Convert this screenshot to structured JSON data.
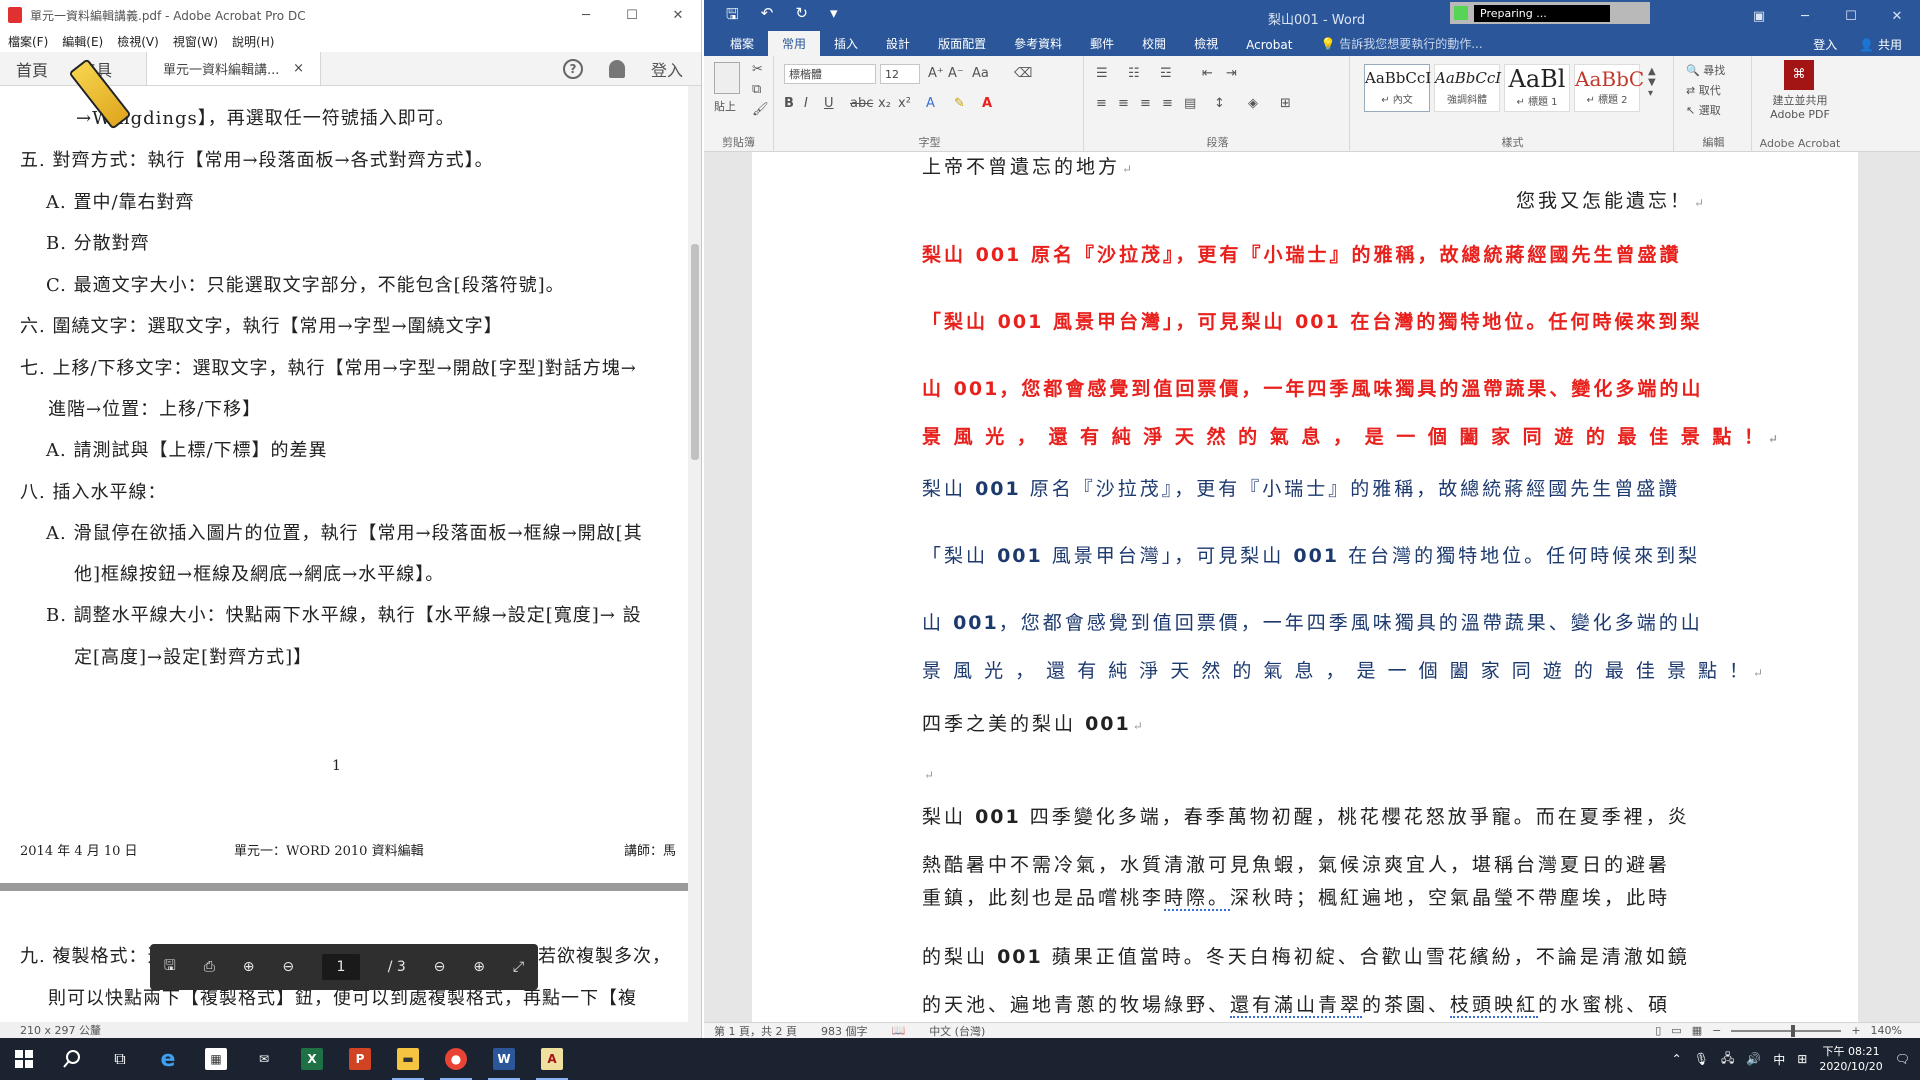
{
  "acrobat": {
    "window_title": "單元一資料編輯講義.pdf - Adobe Acrobat Pro DC",
    "window_controls": [
      "─",
      "☐",
      "✕"
    ],
    "menu": [
      "檔案(F)",
      "編輯(E)",
      "檢視(V)",
      "視窗(W)",
      "說明(H)"
    ],
    "tabs": {
      "home": "首頁",
      "tools": "工具",
      "doc": "單元一資料編輯講...",
      "close": "×",
      "signin": "登入",
      "help": "?"
    },
    "page_lines": [
      "→Wingdings】，再選取任一符號插入即可。",
      "五. 對齊方式：執行【常用→段落面板→各式對齊方式】。",
      "A.  置中/靠右對齊",
      "B.  分散對齊",
      "C.  最適文字大小：只能選取文字部分，不能包含[段落符號]。",
      "六. 圍繞文字：選取文字，執行【常用→字型→圍繞文字】",
      "七. 上移/下移文字：選取文字，執行【常用→字型→開啟[字型]對話方塊→",
      "進階→位置：上移/下移】",
      "A.  請測試與【上標/下標】的差異",
      "八. 插入水平線：",
      "A.  滑鼠停在欲插入圖片的位置，執行【常用→段落面板→框線→開啟[其",
      "他]框線按鈕→框線及網底→網底→水平線】。",
      "B.  調整水平線大小：快點兩下水平線，執行【水平線→設定[寬度]→ 設",
      "定[高度]→設定[對齊方式]】"
    ],
    "page_number": "1",
    "header_date": "2014 年 4 月 10 日",
    "header_unit": "單元一：WORD 2010 資料編輯",
    "header_teacher": "講師：馬",
    "page2_lines": [
      "九. 複製格式：選",
      "若欲複製多次，",
      "則可以快點兩下【複製格式】鈕，便可以到處複製格式，再點一下【複"
    ],
    "status_size": "210 x 297 公釐",
    "toolbar": {
      "current_page": "1",
      "total_pages": "/ 3"
    }
  },
  "word": {
    "window_title": "梨山001 - Word",
    "preparing": "Preparing ...",
    "ribbon_tabs": [
      "檔案",
      "常用",
      "插入",
      "設計",
      "版面配置",
      "參考資料",
      "郵件",
      "校閱",
      "檢視",
      "Acrobat"
    ],
    "active_tab": "常用",
    "tell_me": "告訴我您想要執行的動作...",
    "signin": "登入",
    "share": "共用",
    "groups": {
      "clipboard": "剪貼簿",
      "font": "字型",
      "paragraph": "段落",
      "styles": "樣式",
      "editing": "編輯",
      "acrobat": "Adobe Acrobat"
    },
    "paste": "貼上",
    "font_name": "標楷體",
    "font_size": "12",
    "styles": [
      {
        "sample": "AaBbCcI",
        "name": "↵ 內文"
      },
      {
        "sample": "AaBbCcI",
        "name": "強調斜體"
      },
      {
        "sample": "AaBl",
        "name": "↵ 標題 1"
      },
      {
        "sample": "AaBbC",
        "name": "↵ 標題 2"
      }
    ],
    "editing": {
      "find": "尋找",
      "replace": "取代",
      "select": "選取"
    },
    "acrobat_btn": [
      "建立並共用",
      "Adobe PDF"
    ],
    "doc": {
      "line1": "上帝不曾遺忘的地方",
      "line2": "您我又怎能遺忘！",
      "para_red": [
        [
          "梨山",
          "001",
          "原名『沙拉茂』，更有『小瑞士』的雅稱，故總統蔣經國先生曾盛讚"
        ],
        [
          "「梨山",
          "001",
          "風景甲台灣」，可見梨山",
          "001",
          "在台灣的獨特地位。任何時候來到梨"
        ],
        [
          "山",
          "001",
          "，您都會感覺到值回票價，一年四季風味獨具的溫帶蔬果、變化多端的山"
        ],
        [
          "景 風 光 ， 還 有 純 淨 天 然 的 氣 息 ， 是 一 個 闔 家 同 遊 的 最 佳 景 點 ！"
        ]
      ],
      "heading": [
        "四季之美的梨山",
        "001"
      ],
      "para3": [
        [
          "梨山",
          "001",
          "四季變化多端，春季萬物初醒，桃花櫻花怒放爭寵。而在夏季裡，炎"
        ],
        [
          "熱酷暑中不需冷氣，水質清澈可見魚蝦，氣候涼爽宜人，堪稱台灣夏日的避暑"
        ],
        [
          "重鎮，此刻也是品嚐桃李",
          "時際。",
          "深秋時；楓紅遍地，空氣晶瑩不帶塵埃，此時"
        ],
        [
          "的梨山",
          "001",
          "蘋果正值當時。冬天白梅初綻、合歡山雪花繽紛，不論是清澈如鏡"
        ],
        [
          "的天池、遍地青蔥的牧場綠野、",
          "還有滿山青翠",
          "的茶園、",
          "枝頭映紅",
          "的水蜜桃、碩"
        ]
      ]
    },
    "status": {
      "page": "第 1 頁，共 2 頁",
      "words": "983 個字",
      "lang": "中文 (台灣)",
      "zoom": "140%"
    }
  },
  "taskbar": {
    "time": "下午 08:21",
    "date": "2020/10/20",
    "ime": "中"
  }
}
